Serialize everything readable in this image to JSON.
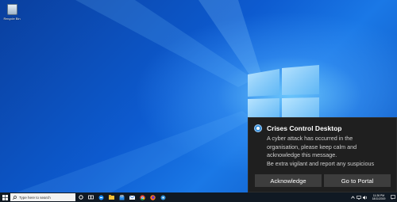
{
  "desktop": {
    "recycle_bin_label": "Recycle Bin"
  },
  "toast": {
    "title": "Crises Control Desktop",
    "body_lines": [
      "A cyber attack has occurred in the",
      "organisation, please keep calm and",
      "acknowledge this message.",
      "Be extra vigilant and report any suspicious"
    ],
    "acknowledge_label": "Acknowledge",
    "portal_label": "Go to Portal",
    "icon": "crises-control-app-icon"
  },
  "taskbar": {
    "search_placeholder": "Type here to search",
    "pinned_icons": [
      "cortana-icon",
      "task-view-icon",
      "edge-icon",
      "file-explorer-icon",
      "store-icon",
      "mail-icon",
      "chrome-icon",
      "firefox-icon",
      "crises-control-icon"
    ],
    "clock_time": "11:26 PM",
    "clock_date": "18/11/2019"
  },
  "colors": {
    "desktop_blue": "#0d5bd0",
    "toast_bg": "#1f1f1f",
    "button_bg": "#3d3d3d",
    "taskbar_bg": "#101923"
  }
}
